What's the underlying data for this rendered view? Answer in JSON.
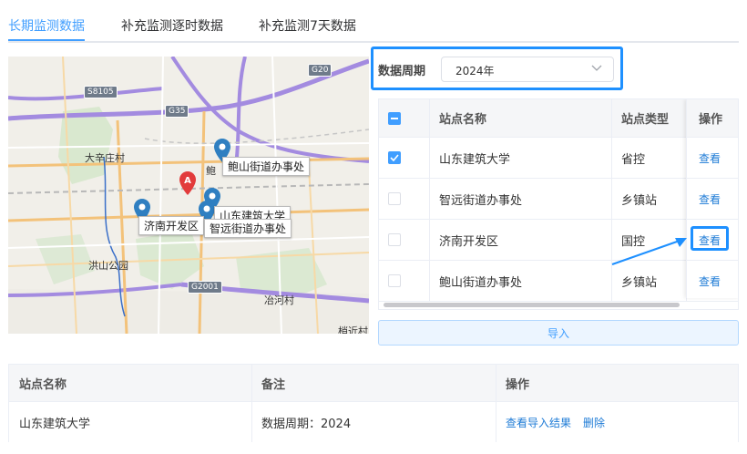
{
  "tabs": [
    {
      "label": "长期监测数据",
      "active": true
    },
    {
      "label": "补充监测逐时数据",
      "active": false
    },
    {
      "label": "补充监测7天数据",
      "active": false
    }
  ],
  "map": {
    "place_labels": [
      "大辛庄村",
      "洪山公园",
      "冶河村",
      "梢近村",
      "鲍"
    ],
    "road_shields": [
      "S8105",
      "G35",
      "G20",
      "G2001"
    ],
    "markers": [
      {
        "label": "鲍山街道办事处"
      },
      {
        "label": "山东建筑大学"
      },
      {
        "label": "济南开发区"
      },
      {
        "label": "智远街道办事处"
      }
    ],
    "pin_letter": "A"
  },
  "period": {
    "label": "数据周期",
    "value": "2024年"
  },
  "station_table": {
    "headers": {
      "name": "站点名称",
      "type": "站点类型",
      "op": "操作"
    },
    "rows": [
      {
        "name": "山东建筑大学",
        "type": "省控",
        "op": "查看",
        "checked": true
      },
      {
        "name": "智远街道办事处",
        "type": "乡镇站",
        "op": "查看",
        "checked": false
      },
      {
        "name": "济南开发区",
        "type": "国控",
        "op": "查看",
        "checked": false
      },
      {
        "name": "鲍山街道办事处",
        "type": "乡镇站",
        "op": "查看",
        "checked": false
      }
    ]
  },
  "import_label": "导入",
  "result_table": {
    "headers": {
      "name": "站点名称",
      "note": "备注",
      "op": "操作"
    },
    "rows": [
      {
        "name": "山东建筑大学",
        "note": "数据周期：2024",
        "view": "查看导入结果",
        "delete": "删除"
      }
    ]
  },
  "colors": {
    "accent": "#409eff",
    "highlight": "#1e90ff",
    "marker": "#2f7fc1",
    "pin": "#e23b3b"
  }
}
